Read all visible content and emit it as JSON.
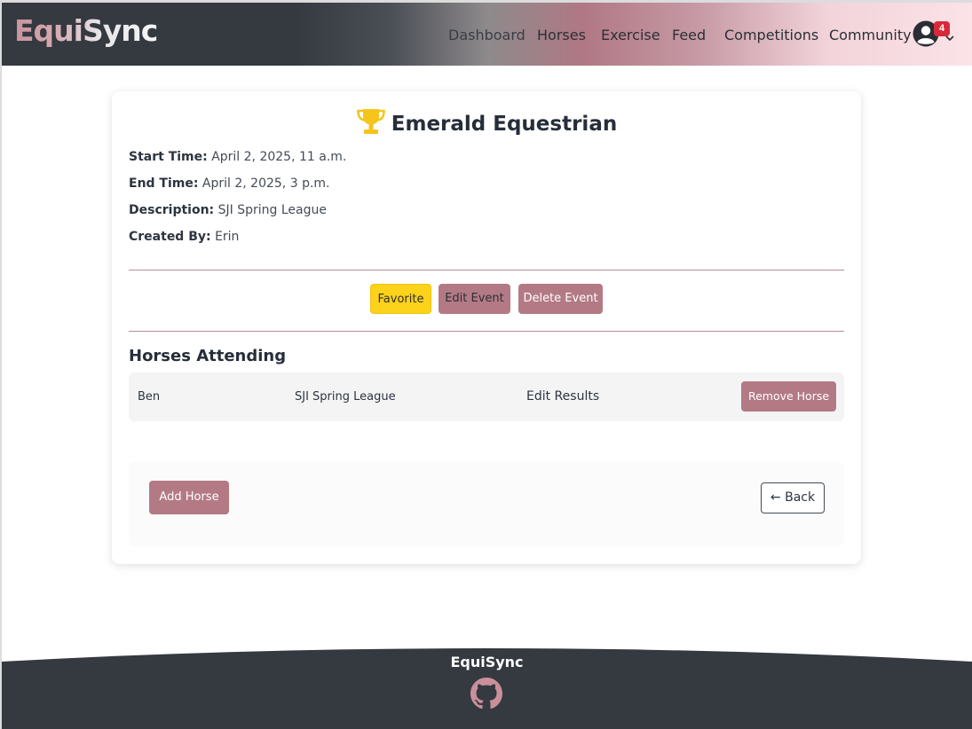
{
  "navbar": {
    "brand": "EquiSync",
    "links": [
      "Dashboard",
      "Horses",
      "Exercise",
      "Feed",
      "Competitions",
      "Community"
    ],
    "user_icon": "user-circle-icon",
    "notification_count": "4"
  },
  "event": {
    "title": "Emerald Equestrian",
    "icon": "trophy-icon",
    "details": [
      {
        "label": "Start Time:",
        "value": "April 2, 2025, 11 a.m."
      },
      {
        "label": "End Time:",
        "value": "April 2, 2025, 3 p.m."
      },
      {
        "label": "Description:",
        "value": "SJI Spring League"
      },
      {
        "label": "Created By:",
        "value": "Erin"
      }
    ]
  },
  "event_actions": {
    "favorite": "Favorite",
    "edit": "Edit Event",
    "delete": "Delete Event"
  },
  "horses_section": {
    "title": "Horses Attending",
    "rows": [
      {
        "name": "Ben",
        "event": "SJI Spring League",
        "results_link": "Edit Results",
        "remove": "Remove Horse"
      }
    ]
  },
  "bottom_actions": {
    "add_horse": "Add Horse",
    "back": "← Back"
  },
  "footer": {
    "brand": "EquiSync",
    "icon": "github-icon"
  },
  "colors": {
    "accent": "#b37a86",
    "favorite": "#fcd21a",
    "dark": "#353940",
    "badge": "#d8293b"
  }
}
